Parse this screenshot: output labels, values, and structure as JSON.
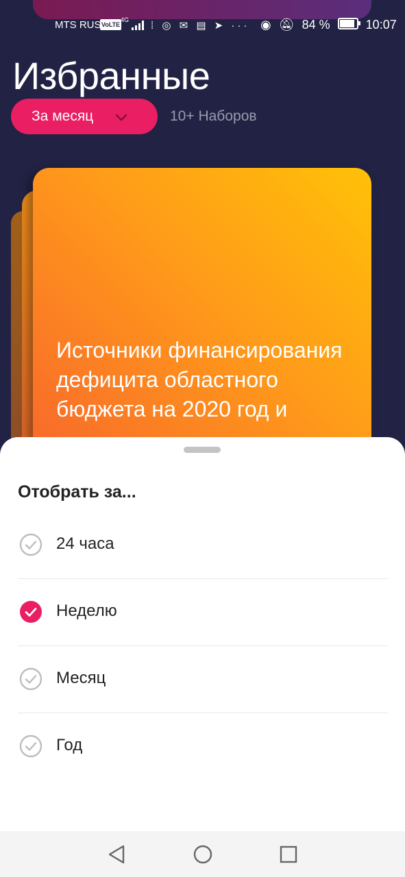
{
  "status_bar": {
    "carrier": "MTS RUS",
    "volte": "VoLTE",
    "network": "4G",
    "battery": "84 %",
    "time": "10:07"
  },
  "header": {
    "title": "Избранные",
    "filter_label": "За месяц",
    "count_label": "10+ Наборов"
  },
  "card": {
    "title": "Источники финансирования дефицита областного бюджета на 2020 год и"
  },
  "sheet": {
    "title": "Отобрать за...",
    "options": [
      {
        "label": "24 часа",
        "checked": false
      },
      {
        "label": "Неделю",
        "checked": true
      },
      {
        "label": "Месяц",
        "checked": false
      },
      {
        "label": "Год",
        "checked": false
      }
    ]
  },
  "colors": {
    "background": "#222244",
    "accent": "#e91e63",
    "card_gradient_start": "#ffc107",
    "card_gradient_end": "#f7652c"
  },
  "icons": {
    "nav": [
      "back-triangle-icon",
      "home-circle-icon",
      "recents-square-icon"
    ]
  }
}
